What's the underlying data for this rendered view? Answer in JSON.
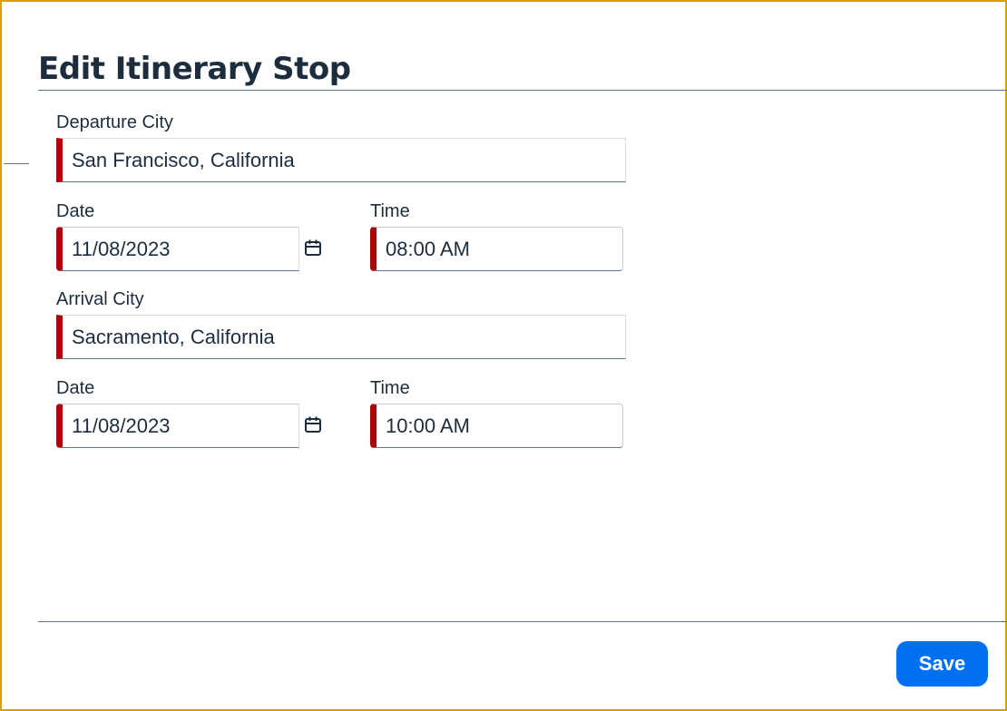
{
  "page": {
    "title": "Edit Itinerary Stop"
  },
  "departure": {
    "city_label": "Departure City",
    "city_value": "San Francisco, California",
    "date_label": "Date",
    "date_value": "11/08/2023",
    "time_label": "Time",
    "time_value": "08:00 AM"
  },
  "arrival": {
    "city_label": "Arrival City",
    "city_value": "Sacramento, California",
    "date_label": "Date",
    "date_value": "11/08/2023",
    "time_label": "Time",
    "time_value": "10:00 AM"
  },
  "footer": {
    "save_label": "Save"
  },
  "colors": {
    "required_marker": "#aa0808",
    "primary_button": "#0070f2",
    "frame_border": "#d4a017",
    "divider": "#5b738b",
    "text": "#1d2d3e"
  },
  "icons": {
    "date_picker": "calendar-icon"
  }
}
